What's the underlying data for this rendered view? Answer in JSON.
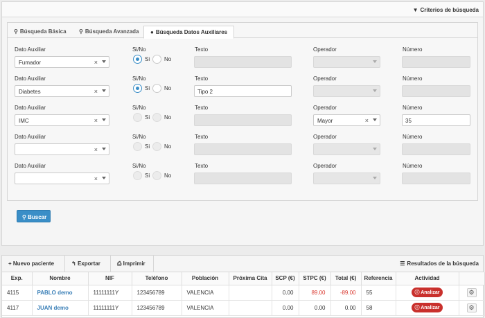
{
  "criteria": {
    "title": "Criterios de búsqueda",
    "tabs": [
      {
        "label": "Búsqueda Básica",
        "icon": "search-icon"
      },
      {
        "label": "Búsqueda Avanzada",
        "icon": "search-plus-icon"
      },
      {
        "label": "Búsqueda Datos Auxiliares",
        "icon": "info-circle-icon",
        "active": true
      }
    ],
    "labels": {
      "dato_auxiliar": "Dato Auxiliar",
      "si_no": "Si/No",
      "si": "Si",
      "no": "No",
      "texto": "Texto",
      "operador": "Operador",
      "numero": "Número"
    },
    "rows": [
      {
        "dato": "Fumador",
        "radio": "si",
        "texto": "",
        "texto_enabled": false,
        "operador": "",
        "operador_enabled": false,
        "numero": "",
        "numero_enabled": false
      },
      {
        "dato": "Diabetes",
        "radio": "si",
        "texto": "Tipo 2",
        "texto_enabled": true,
        "operador": "",
        "operador_enabled": false,
        "numero": "",
        "numero_enabled": false
      },
      {
        "dato": "IMC",
        "radio": "",
        "texto": "",
        "texto_enabled": false,
        "operador": "Mayor",
        "operador_enabled": true,
        "numero": "35",
        "numero_enabled": true
      },
      {
        "dato": "",
        "radio": "",
        "texto": "",
        "texto_enabled": false,
        "operador": "",
        "operador_enabled": false,
        "numero": "",
        "numero_enabled": false
      },
      {
        "dato": "",
        "radio": "",
        "texto": "",
        "texto_enabled": false,
        "operador": "",
        "operador_enabled": false,
        "numero": "",
        "numero_enabled": false
      }
    ],
    "buscar_label": "Buscar"
  },
  "results": {
    "title": "Resultados de la búsqueda",
    "toolbar": {
      "nuevo": "Nuevo paciente",
      "exportar": "Exportar",
      "imprimir": "Imprimir"
    },
    "columns": [
      "Exp.",
      "Nombre",
      "NIF",
      "Teléfono",
      "Población",
      "Próxima Cita",
      "SCP (€)",
      "STPC (€)",
      "Total (€)",
      "Referencia",
      "Actividad",
      ""
    ],
    "rows": [
      {
        "exp": "4115",
        "nombre": "PABLO demo",
        "nif": "11111111Y",
        "telefono": "123456789",
        "poblacion": "VALENCIA",
        "cita": "",
        "scp": "0.00",
        "stpc": "89.00",
        "total": "-89.00",
        "referencia": "55",
        "actividad": "Analizar"
      },
      {
        "exp": "4117",
        "nombre": "JUAN demo",
        "nif": "11111111Y",
        "telefono": "123456789",
        "poblacion": "VALENCIA",
        "cita": "",
        "scp": "0.00",
        "stpc": "0.00",
        "total": "0.00",
        "referencia": "58",
        "actividad": "Analizar"
      }
    ]
  },
  "colors": {
    "primary": "#3a8ec7",
    "danger": "#c9302c",
    "negative_text": "#d9342b",
    "link": "#3a7fb7"
  }
}
